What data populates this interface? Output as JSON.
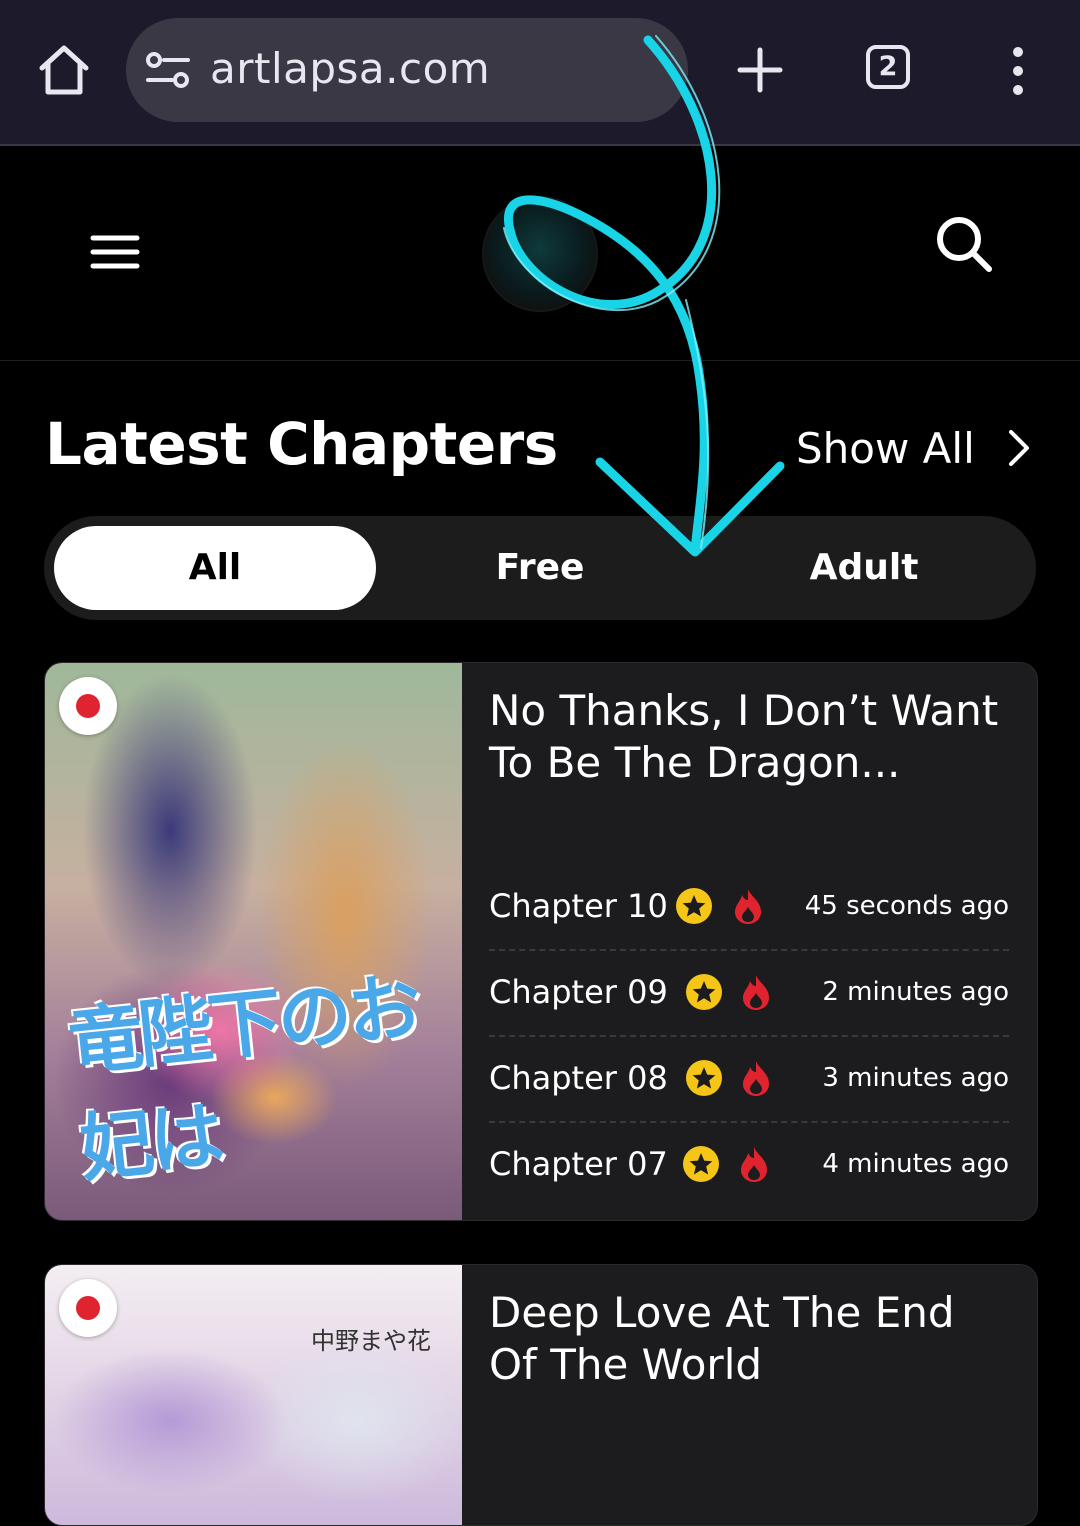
{
  "browser": {
    "url": "artlapsa.com",
    "tab_count": "2"
  },
  "section": {
    "title": "Latest Chapters",
    "show_all": "Show All"
  },
  "tabs": [
    {
      "label": "All",
      "active": true
    },
    {
      "label": "Free",
      "active": false
    },
    {
      "label": "Adult",
      "active": false
    }
  ],
  "cards": [
    {
      "title": "No Thanks, I Don’t Want To Be The Dragon...",
      "cover_text": "竜陛下のお妃は",
      "chapters": [
        {
          "label": "Chapter 10",
          "time": "45 seconds ago"
        },
        {
          "label": "Chapter 09",
          "time": "2 minutes ago"
        },
        {
          "label": "Chapter 08",
          "time": "3 minutes ago"
        },
        {
          "label": "Chapter 07",
          "time": "4 minutes ago"
        }
      ]
    },
    {
      "title": "Deep Love At The End Of The World",
      "cover_text": "中野まや花"
    }
  ],
  "colors": {
    "browser_bar": "#1d1b2b",
    "accent_star": "#f5c518",
    "fire": "#e0242f",
    "annotation": "#19d3e6"
  }
}
